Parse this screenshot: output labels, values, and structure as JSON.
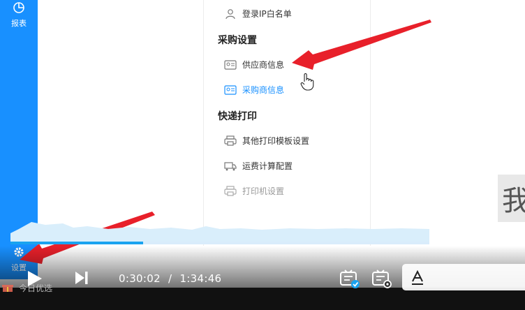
{
  "sidebar": {
    "report_label": "报表",
    "settings_label": "设置"
  },
  "menu": {
    "login_whitelist": "登录IP白名单",
    "purchase_section": "采购设置",
    "supplier_info": "供应商信息",
    "purchaser_info": "采购商信息",
    "express_section": "快递打印",
    "other_template": "其他打印模板设置",
    "freight_calc": "运费计算配置",
    "printer_settings": "打印机设置"
  },
  "player": {
    "current_time": "0:30:02",
    "separator": "/",
    "total_time": "1:34:46",
    "progress": 0.317
  },
  "overlay": {
    "side_char": "我"
  },
  "promo": {
    "label": "今日优选"
  },
  "colors": {
    "rail": "#1890ff",
    "accent": "#1890ff",
    "arrow": "#e8202a",
    "progress": "#1aa3f0"
  }
}
